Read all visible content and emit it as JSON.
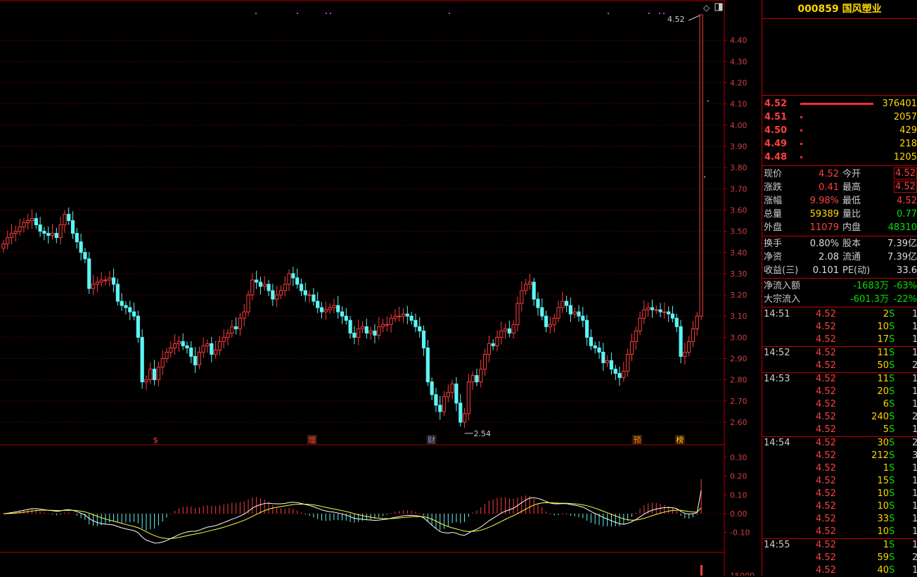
{
  "stock": {
    "title": "000859 国风塑业"
  },
  "order_book": [
    {
      "price": "4.52",
      "volume": "376401",
      "fill": 1.0
    },
    {
      "price": "4.51",
      "volume": "2057",
      "fill": 0.01
    },
    {
      "price": "4.50",
      "volume": "429",
      "fill": 0.01
    },
    {
      "price": "4.49",
      "volume": "218",
      "fill": 0.01
    },
    {
      "price": "4.48",
      "volume": "1205",
      "fill": 0.01
    }
  ],
  "quote": [
    {
      "l1": "现价",
      "v1": "4.52",
      "c1": "red",
      "l2": "今开",
      "v2": "4.52",
      "c2": "red",
      "boxed": true
    },
    {
      "l1": "涨跌",
      "v1": "0.41",
      "c1": "red",
      "l2": "最高",
      "v2": "4.52",
      "c2": "red",
      "boxed": true
    },
    {
      "l1": "涨幅",
      "v1": "9.98%",
      "c1": "red",
      "l2": "最低",
      "v2": "4.52",
      "c2": "red",
      "boxed": false
    },
    {
      "l1": "总量",
      "v1": "59389",
      "c1": "yellow",
      "l2": "量比",
      "v2": "0.77",
      "c2": "green",
      "boxed": false
    },
    {
      "l1": "外盘",
      "v1": "11079",
      "c1": "red",
      "l2": "内盘",
      "v2": "48310",
      "c2": "green",
      "boxed": false
    }
  ],
  "quote2": [
    {
      "l1": "换手",
      "v1": "0.80%",
      "c1": "white",
      "l2": "股本",
      "v2": "7.39亿",
      "c2": "white"
    },
    {
      "l1": "净资",
      "v1": "2.08",
      "c1": "white",
      "l2": "流通",
      "v2": "7.39亿",
      "c2": "white"
    },
    {
      "l1": "收益(三)",
      "v1": "0.101",
      "c1": "white",
      "l2": "PE(动)",
      "v2": "33.6",
      "c2": "white"
    }
  ],
  "flows": [
    {
      "label": "净流入额",
      "value": "-1683万",
      "pct": "-63%"
    },
    {
      "label": "大宗流入",
      "value": "-601.3万",
      "pct": "-22%"
    }
  ],
  "ticks": [
    {
      "time": "14:51",
      "price": "4.52",
      "vol": "2",
      "side": "S",
      "num": "1",
      "sep": false
    },
    {
      "time": "",
      "price": "4.52",
      "vol": "10",
      "side": "S",
      "num": "1",
      "sep": false
    },
    {
      "time": "",
      "price": "4.52",
      "vol": "17",
      "side": "S",
      "num": "1",
      "sep": false
    },
    {
      "time": "14:52",
      "price": "4.52",
      "vol": "11",
      "side": "S",
      "num": "1",
      "sep": true
    },
    {
      "time": "",
      "price": "4.52",
      "vol": "50",
      "side": "S",
      "num": "2",
      "sep": false
    },
    {
      "time": "14:53",
      "price": "4.52",
      "vol": "11",
      "side": "S",
      "num": "1",
      "sep": true
    },
    {
      "time": "",
      "price": "4.52",
      "vol": "20",
      "side": "S",
      "num": "1",
      "sep": false
    },
    {
      "time": "",
      "price": "4.52",
      "vol": "6",
      "side": "S",
      "num": "1",
      "sep": false
    },
    {
      "time": "",
      "price": "4.52",
      "vol": "240",
      "side": "S",
      "num": "2",
      "sep": false
    },
    {
      "time": "",
      "price": "4.52",
      "vol": "5",
      "side": "S",
      "num": "1",
      "sep": false
    },
    {
      "time": "14:54",
      "price": "4.52",
      "vol": "30",
      "side": "S",
      "num": "2",
      "sep": true
    },
    {
      "time": "",
      "price": "4.52",
      "vol": "212",
      "side": "S",
      "num": "3",
      "sep": false
    },
    {
      "time": "",
      "price": "4.52",
      "vol": "1",
      "side": "S",
      "num": "1",
      "sep": false
    },
    {
      "time": "",
      "price": "4.52",
      "vol": "15",
      "side": "S",
      "num": "1",
      "sep": false
    },
    {
      "time": "",
      "price": "4.52",
      "vol": "10",
      "side": "S",
      "num": "1",
      "sep": false
    },
    {
      "time": "",
      "price": "4.52",
      "vol": "10",
      "side": "S",
      "num": "1",
      "sep": false
    },
    {
      "time": "",
      "price": "4.52",
      "vol": "33",
      "side": "S",
      "num": "1",
      "sep": false
    },
    {
      "time": "",
      "price": "4.52",
      "vol": "10",
      "side": "S",
      "num": "1",
      "sep": false
    },
    {
      "time": "14:55",
      "price": "4.52",
      "vol": "1",
      "side": "S",
      "num": "1",
      "sep": true
    },
    {
      "time": "",
      "price": "4.52",
      "vol": "59",
      "side": "S",
      "num": "2",
      "sep": false
    },
    {
      "time": "",
      "price": "4.52",
      "vol": "40",
      "side": "S",
      "num": "1",
      "sep": false
    }
  ],
  "chart_data": {
    "type": "candlestick",
    "price_axis": {
      "ylim": [
        2.5,
        4.52
      ],
      "ticks": [
        "4.40",
        "4.30",
        "4.20",
        "4.10",
        "4.00",
        "3.90",
        "3.80",
        "3.70",
        "3.60",
        "3.50",
        "3.40",
        "3.30",
        "3.20",
        "3.10",
        "3.00",
        "2.90",
        "2.80",
        "2.70",
        "2.60"
      ]
    },
    "annotations": [
      {
        "text": "4.52",
        "arrow": true,
        "kind": "high"
      },
      {
        "text": "2.54",
        "arrow": true,
        "kind": "low"
      }
    ],
    "event_markers": [
      {
        "text": "$",
        "color": "#ff4040",
        "at": 0.207
      },
      {
        "text": "增",
        "color": "#ff4040",
        "at": 0.423
      },
      {
        "text": "财",
        "color": "#4da6ff",
        "at": 0.588
      },
      {
        "text": "预",
        "color": "#ff8c00",
        "at": 0.872
      },
      {
        "text": "榜",
        "color": "#ffd700",
        "at": 0.931
      }
    ],
    "macd_axis": {
      "ylim": [
        -0.15,
        0.35
      ],
      "ticks": [
        "0.30",
        "0.20",
        "0.10",
        "0.00",
        "-0.10"
      ]
    },
    "volume_axis_tick": "15000",
    "closes": [
      3.44,
      3.47,
      3.49,
      3.5,
      3.52,
      3.54,
      3.55,
      3.56,
      3.53,
      3.5,
      3.49,
      3.48,
      3.49,
      3.47,
      3.53,
      3.58,
      3.55,
      3.49,
      3.45,
      3.4,
      3.37,
      3.23,
      3.25,
      3.26,
      3.27,
      3.27,
      3.28,
      3.25,
      3.17,
      3.15,
      3.14,
      3.12,
      3.1,
      3.0,
      2.79,
      2.8,
      2.85,
      2.8,
      2.86,
      2.9,
      2.93,
      2.95,
      2.97,
      2.98,
      2.96,
      2.95,
      2.91,
      2.87,
      2.93,
      2.96,
      2.97,
      2.92,
      2.94,
      2.98,
      3.0,
      3.02,
      3.05,
      3.04,
      3.09,
      3.12,
      3.2,
      3.27,
      3.26,
      3.24,
      3.25,
      3.22,
      3.18,
      3.2,
      3.22,
      3.25,
      3.3,
      3.28,
      3.25,
      3.22,
      3.2,
      3.2,
      3.17,
      3.14,
      3.12,
      3.13,
      3.14,
      3.15,
      3.12,
      3.1,
      3.08,
      3.02,
      3.0,
      3.04,
      3.05,
      3.02,
      3.03,
      3.01,
      3.05,
      3.06,
      3.06,
      3.09,
      3.1,
      3.1,
      3.11,
      3.1,
      3.08,
      3.05,
      3.03,
      2.95,
      2.79,
      2.73,
      2.68,
      2.65,
      2.72,
      2.74,
      2.78,
      2.69,
      2.6,
      2.64,
      2.79,
      2.82,
      2.79,
      2.85,
      2.92,
      2.97,
      2.96,
      3.0,
      3.03,
      3.04,
      3.02,
      3.06,
      3.16,
      3.22,
      3.25,
      3.26,
      3.18,
      3.14,
      3.1,
      3.05,
      3.06,
      3.09,
      3.14,
      3.17,
      3.15,
      3.11,
      3.12,
      3.1,
      3.08,
      3.0,
      2.96,
      2.95,
      2.93,
      2.88,
      2.89,
      2.85,
      2.83,
      2.81,
      2.84,
      2.92,
      2.98,
      3.03,
      3.09,
      3.13,
      3.14,
      3.13,
      3.13,
      3.12,
      3.12,
      3.11,
      3.09,
      3.05,
      2.91,
      2.93,
      2.98,
      3.04,
      3.1,
      4.52
    ]
  }
}
